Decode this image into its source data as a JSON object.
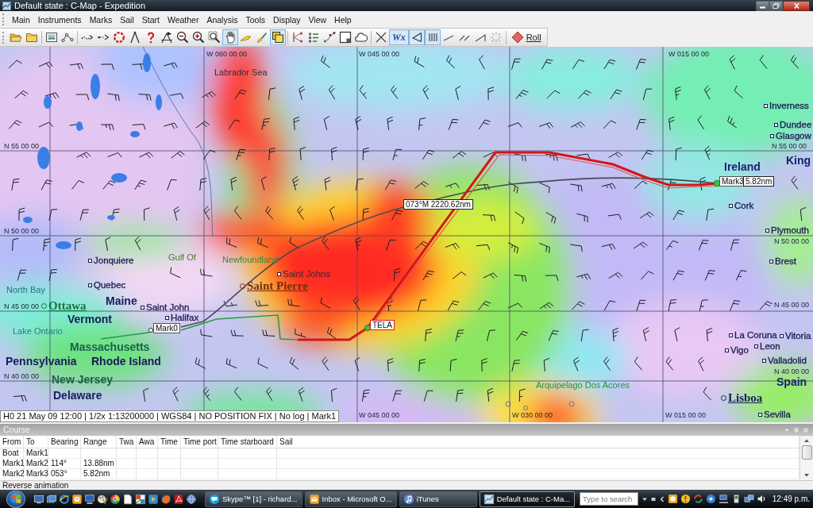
{
  "window": {
    "title": "Default state : C-Map - Expedition"
  },
  "menu": [
    "Main",
    "Instruments",
    "Marks",
    "Sail",
    "Start",
    "Weather",
    "Analysis",
    "Tools",
    "Display",
    "View",
    "Help"
  ],
  "toolbar": {
    "groups": [
      [
        {
          "kind": "open",
          "selected": false
        },
        {
          "kind": "folder",
          "selected": false
        }
      ],
      [
        {
          "kind": "save",
          "selected": false
        },
        {
          "kind": "nodes",
          "selected": false
        }
      ],
      [
        {
          "kind": "trail",
          "selected": false
        },
        {
          "kind": "trail-dots",
          "selected": false
        },
        {
          "kind": "target",
          "selected": false
        },
        {
          "kind": "dividers",
          "selected": false
        },
        {
          "kind": "help",
          "selected": false
        },
        {
          "kind": "ruler",
          "selected": false
        },
        {
          "kind": "zoom-out",
          "selected": false
        },
        {
          "kind": "zoom-in",
          "selected": false
        },
        {
          "kind": "zoom-box",
          "selected": false
        },
        {
          "kind": "pan",
          "selected": true
        },
        {
          "kind": "marker",
          "selected": false
        },
        {
          "kind": "brush",
          "selected": false
        },
        {
          "kind": "layers",
          "selected": true
        }
      ],
      [
        {
          "kind": "route-edit",
          "selected": false
        },
        {
          "kind": "list",
          "selected": false
        },
        {
          "kind": "route-points",
          "selected": false
        },
        {
          "kind": "frame",
          "selected": false
        },
        {
          "kind": "cloud",
          "selected": false
        }
      ],
      [
        {
          "kind": "cross",
          "selected": false
        },
        {
          "kind": "text",
          "label": "Wx",
          "selected": true
        },
        {
          "kind": "triangle",
          "selected": true
        },
        {
          "kind": "bars",
          "selected": true
        },
        {
          "kind": "slash",
          "selected": false
        },
        {
          "kind": "double-slash",
          "selected": false
        },
        {
          "kind": "angle",
          "selected": false
        },
        {
          "kind": "sparkle",
          "selected": false
        }
      ],
      [
        {
          "kind": "roll",
          "label": "Roll",
          "selected": false
        }
      ]
    ]
  },
  "map": {
    "grid_labels": [
      "W 060 00 00",
      "W 045 00 00",
      "W 015 00 00",
      "N 55 00 00",
      "N 55 00 00",
      "N 50 00 00",
      "N 50 00 00",
      "N 45 00 00",
      "N 45 00 00",
      "N 40 00 00",
      "N 40 00 00",
      "W 045 00 00",
      "W 030 00 00",
      "W 015 00 00"
    ],
    "places": [
      {
        "name": "Labrador Sea",
        "kind": "water",
        "color": "#3a2a3a"
      },
      {
        "name": "Inverness",
        "kind": "city",
        "color": "#1a1a50"
      },
      {
        "name": "Dundee",
        "kind": "city",
        "color": "#1a1a50"
      },
      {
        "name": "Glasgow",
        "kind": "city",
        "color": "#1a1a50"
      },
      {
        "name": "Ireland",
        "kind": "region",
        "color": "#1a2070"
      },
      {
        "name": "King",
        "kind": "region",
        "color": "#1a2070"
      },
      {
        "name": "Cork",
        "kind": "city",
        "color": "#1a1a50"
      },
      {
        "name": "Plymouth",
        "kind": "city",
        "color": "#1a1a50"
      },
      {
        "name": "Jonquiere",
        "kind": "city",
        "color": "#1a1a50"
      },
      {
        "name": "Gulf Of",
        "kind": "water",
        "color": "#4a7a2a"
      },
      {
        "name": "Newfoundland",
        "kind": "water",
        "color": "#2f8a3f"
      },
      {
        "name": "Brest",
        "kind": "city",
        "color": "#1a1a50"
      },
      {
        "name": "Saint Johns",
        "kind": "city",
        "color": "#6a2a2a"
      },
      {
        "name": "North Bay",
        "kind": "water",
        "color": "#1f7a7a"
      },
      {
        "name": "Quebec",
        "kind": "city",
        "color": "#1a1a50"
      },
      {
        "name": "Saint Pierre",
        "kind": "capital",
        "color": "#7a2a0a"
      },
      {
        "name": "Ottawa",
        "kind": "capital",
        "color": "#1a7040"
      },
      {
        "name": "Maine",
        "kind": "region",
        "color": "#1a1a60"
      },
      {
        "name": "Saint John",
        "kind": "city",
        "color": "#1a1a50"
      },
      {
        "name": "Vermont",
        "kind": "region",
        "color": "#1a1a60"
      },
      {
        "name": "Halifax",
        "kind": "city",
        "color": "#1a1a50"
      },
      {
        "name": "Lake Ontario",
        "kind": "water",
        "color": "#2a7a90"
      },
      {
        "name": "La Coruna",
        "kind": "city",
        "color": "#1a1a50"
      },
      {
        "name": "Vitoria",
        "kind": "city",
        "color": "#1a1a50"
      },
      {
        "name": "Massachusetts",
        "kind": "region",
        "color": "#1a6050"
      },
      {
        "name": "Vigo",
        "kind": "city",
        "color": "#1a1a50"
      },
      {
        "name": "Leon",
        "kind": "city",
        "color": "#1a1a50"
      },
      {
        "name": "Pennsylvania",
        "kind": "region",
        "color": "#1a1a60"
      },
      {
        "name": "Rhode Island",
        "kind": "region",
        "color": "#1a1a60"
      },
      {
        "name": "Valladolid",
        "kind": "city",
        "color": "#1a1a50"
      },
      {
        "name": "New Jersey",
        "kind": "region",
        "color": "#1a6040"
      },
      {
        "name": "Arquipelago Dos Acores",
        "kind": "water",
        "color": "#2f8a4a"
      },
      {
        "name": "Spain",
        "kind": "region",
        "color": "#1a2070"
      },
      {
        "name": "Delaware",
        "kind": "region",
        "color": "#1a1a60"
      },
      {
        "name": "Lisboa",
        "kind": "capital",
        "color": "#1a2060"
      },
      {
        "name": "Sevilla",
        "kind": "city",
        "color": "#1a1a50"
      }
    ],
    "route_labels": [
      {
        "text": "073°M 2220.62nm",
        "kind": "leg"
      },
      {
        "text": "Mark0",
        "kind": "mark"
      },
      {
        "text": "TELA",
        "kind": "boat"
      },
      {
        "text": "Mark3",
        "kind": "mark"
      },
      {
        "text": "5.82nm",
        "kind": "leg"
      }
    ],
    "status": "H0 21 May 09 12:00 | 1/2x 1:13200000 | WGS84 | NO POSITION FIX | No log | Mark1"
  },
  "course_panel": {
    "title": "Course",
    "columns": [
      "From",
      "To",
      "Bearing",
      "Range",
      "Twa",
      "Awa",
      "Time",
      "Time port",
      "Time starboard",
      "Sail"
    ],
    "rows": [
      {
        "cells": [
          "Boat",
          "Mark1"
        ]
      },
      {
        "cells": [
          "Mark1",
          "Mark2",
          "114°",
          "13.88nm"
        ]
      },
      {
        "cells": [
          "Mark2",
          "Mark3",
          "053°",
          "5.82nm"
        ]
      }
    ]
  },
  "status_bar": {
    "text": "Reverse animation"
  },
  "taskbar": {
    "quick_launch": [
      {
        "kind": "desktop"
      },
      {
        "kind": "switcher"
      },
      {
        "kind": "browser"
      },
      {
        "kind": "calendar"
      },
      {
        "kind": "computer"
      },
      {
        "kind": "paint"
      },
      {
        "kind": "ring"
      },
      {
        "kind": "document"
      },
      {
        "kind": "picture"
      },
      {
        "kind": "media"
      },
      {
        "kind": "globe"
      },
      {
        "kind": "pdf"
      },
      {
        "kind": "network"
      }
    ],
    "tasks": [
      {
        "kind": "chat",
        "label": "Skype™ [1] - richard...",
        "selected": false
      },
      {
        "kind": "mail",
        "label": "Inbox - Microsoft O...",
        "selected": false
      },
      {
        "kind": "music",
        "label": "iTunes",
        "selected": false
      },
      {
        "kind": "chart",
        "label": "Default state : C-Ma...",
        "selected": true
      }
    ],
    "search": {
      "placeholder": "Type to search"
    },
    "clock": "12:49 p.m."
  }
}
